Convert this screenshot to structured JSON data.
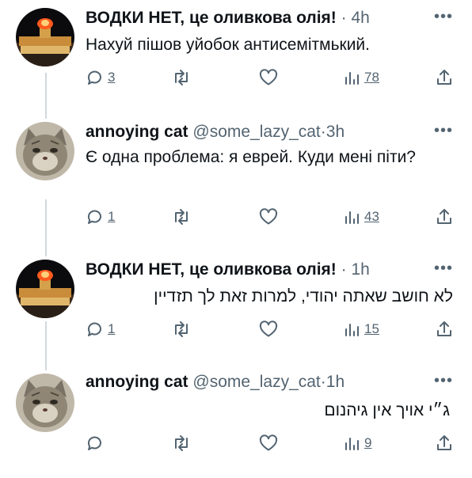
{
  "tweets": [
    {
      "name": "ВОДКИ НЕТ, це оливкова олія!",
      "handle": "",
      "dot": "·",
      "time": "4h",
      "text": "Нахуй пішов уйобок антисемітмький.",
      "rtl": false,
      "replies": "3",
      "views": "78",
      "avatar": "kremlin-night-avatar"
    },
    {
      "name": "annoying cat",
      "handle": "@some_lazy_cat",
      "dot": "·",
      "time": "3h",
      "text": "Є одна проблема: я еврей. Куди мені піти?",
      "rtl": false,
      "replies": "1",
      "views": "43",
      "avatar": "cat-avatar"
    },
    {
      "name": "ВОДКИ НЕТ, це оливкова олія!",
      "handle": "",
      "dot": "·",
      "time": "1h",
      "text": "לא חושב שאתה יהודי, למרות זאת לך תזדיין",
      "rtl": true,
      "replies": "1",
      "views": "15",
      "avatar": "kremlin-night-avatar"
    },
    {
      "name": "annoying cat",
      "handle": "@some_lazy_cat",
      "dot": "·",
      "time": "1h",
      "text": "ג״י אויך אין גיהנום",
      "rtl": true,
      "replies": "",
      "views": "9",
      "avatar": "cat-avatar"
    }
  ],
  "icons": {
    "more": "more-dots-icon",
    "reply": "reply-bubble-icon",
    "retweet": "retweet-arrows-icon",
    "like": "heart-icon",
    "views": "views-bars-icon",
    "share": "share-arrow-icon"
  },
  "more_glyph": "•••",
  "colors": {
    "text": "#0f1419",
    "muted": "#536471",
    "thread_line": "#cfd9de"
  }
}
